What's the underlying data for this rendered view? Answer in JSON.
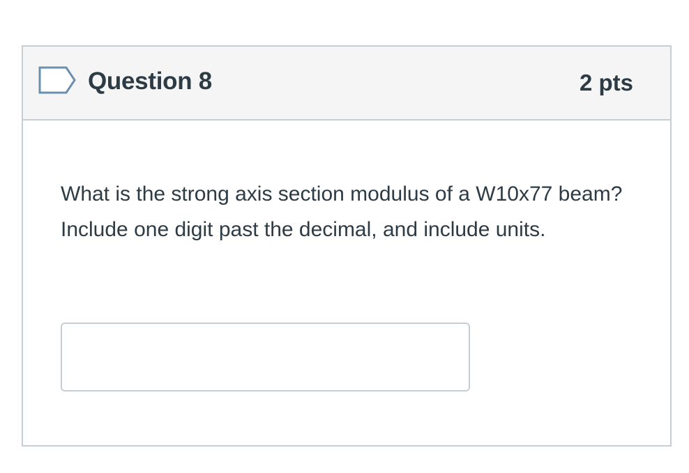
{
  "question": {
    "title": "Question 8",
    "points": "2 pts",
    "flag_icon": "flag-outline-icon",
    "text": "What is the strong axis section modulus of a W10x77 beam?  Include one digit past the decimal, and include units.",
    "answer": {
      "value": "",
      "placeholder": ""
    }
  },
  "colors": {
    "header_bg": "#f5f5f5",
    "border": "#c7cdd1",
    "text": "#2d3b45",
    "flag_stroke": "#6b8fae"
  }
}
